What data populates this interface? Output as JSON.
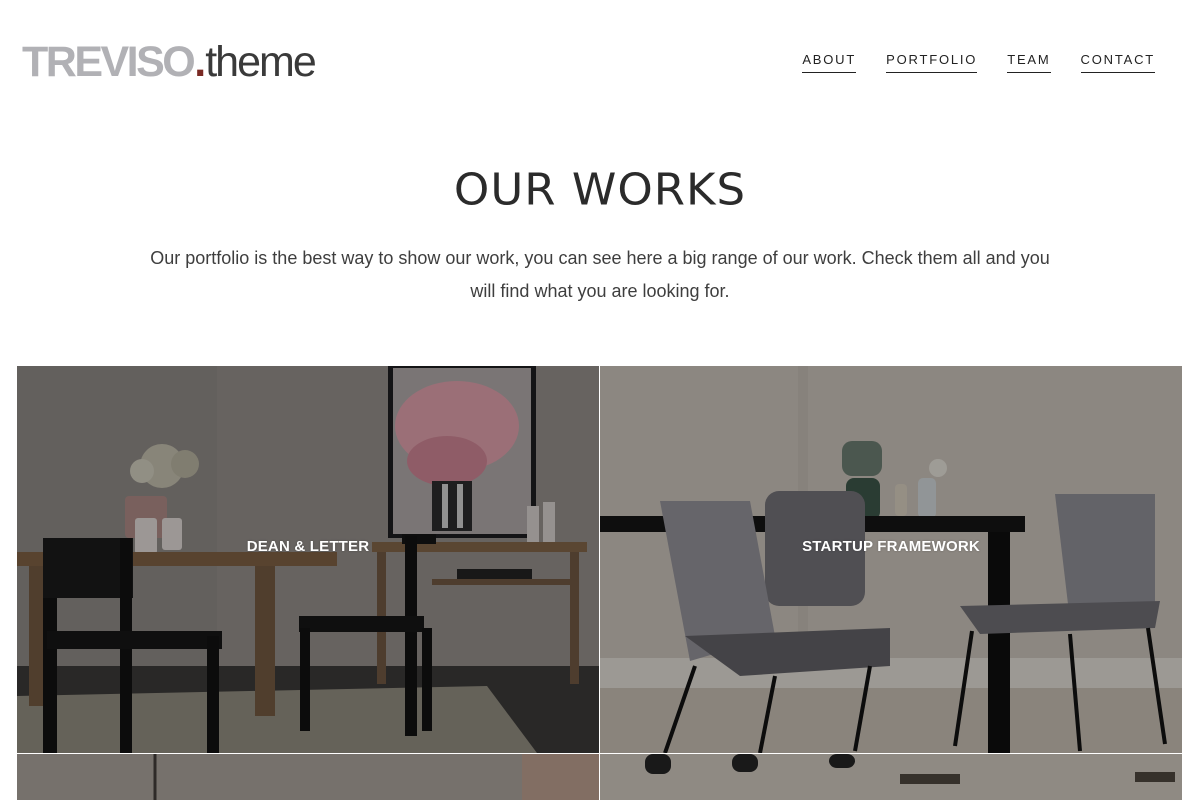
{
  "logo": {
    "brand": "TREVISO",
    "dot": ".",
    "suffix": "theme"
  },
  "nav": [
    {
      "label": "ABOUT"
    },
    {
      "label": "PORTFOLIO"
    },
    {
      "label": "TEAM"
    },
    {
      "label": "CONTACT"
    }
  ],
  "section": {
    "title": "OUR WORKS",
    "description": "Our portfolio is the best way to show our work, you can see here a big range of our work. Check them all and you will find what you are looking for."
  },
  "portfolio": [
    {
      "title": "DEAN & LETTER"
    },
    {
      "title": "STARTUP FRAMEWORK"
    },
    {
      "title": ""
    },
    {
      "title": ""
    }
  ],
  "colors": {
    "logo_gray": "#b1b1b5",
    "logo_dot": "#7a2a24",
    "text": "#2b2b2b"
  }
}
